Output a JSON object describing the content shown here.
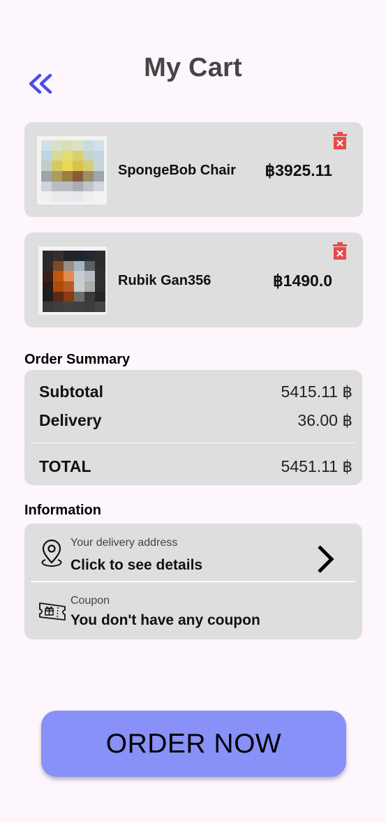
{
  "header": {
    "title": "My Cart",
    "back_icon": "double-chevron-left-icon",
    "accent_color": "#4c4ce8"
  },
  "cart": {
    "currency_symbol": "฿",
    "items": [
      {
        "name": "SpongeBob Chair",
        "price": "฿3925.11"
      },
      {
        "name": "Rubik Gan356",
        "price": "฿1490.0"
      }
    ],
    "delete_icon": "trash-icon",
    "delete_color": "#e84a4a"
  },
  "order_summary": {
    "label": "Order Summary",
    "subtotal_label": "Subtotal",
    "subtotal_value": "5415.11 ฿",
    "delivery_label": "Delivery",
    "delivery_value": "36.00 ฿",
    "total_label": "TOTAL",
    "total_value": "5451.11 ฿"
  },
  "information": {
    "label": "Information",
    "address": {
      "icon": "location-pin-icon",
      "caption": "Your delivery address",
      "value": "Click to see details",
      "action_icon": "chevron-right-icon"
    },
    "coupon": {
      "icon": "coupon-ticket-icon",
      "caption": "Coupon",
      "value": "You don't have any coupon"
    }
  },
  "order_button": {
    "label": "ORDER NOW",
    "color": "#8891f7"
  }
}
